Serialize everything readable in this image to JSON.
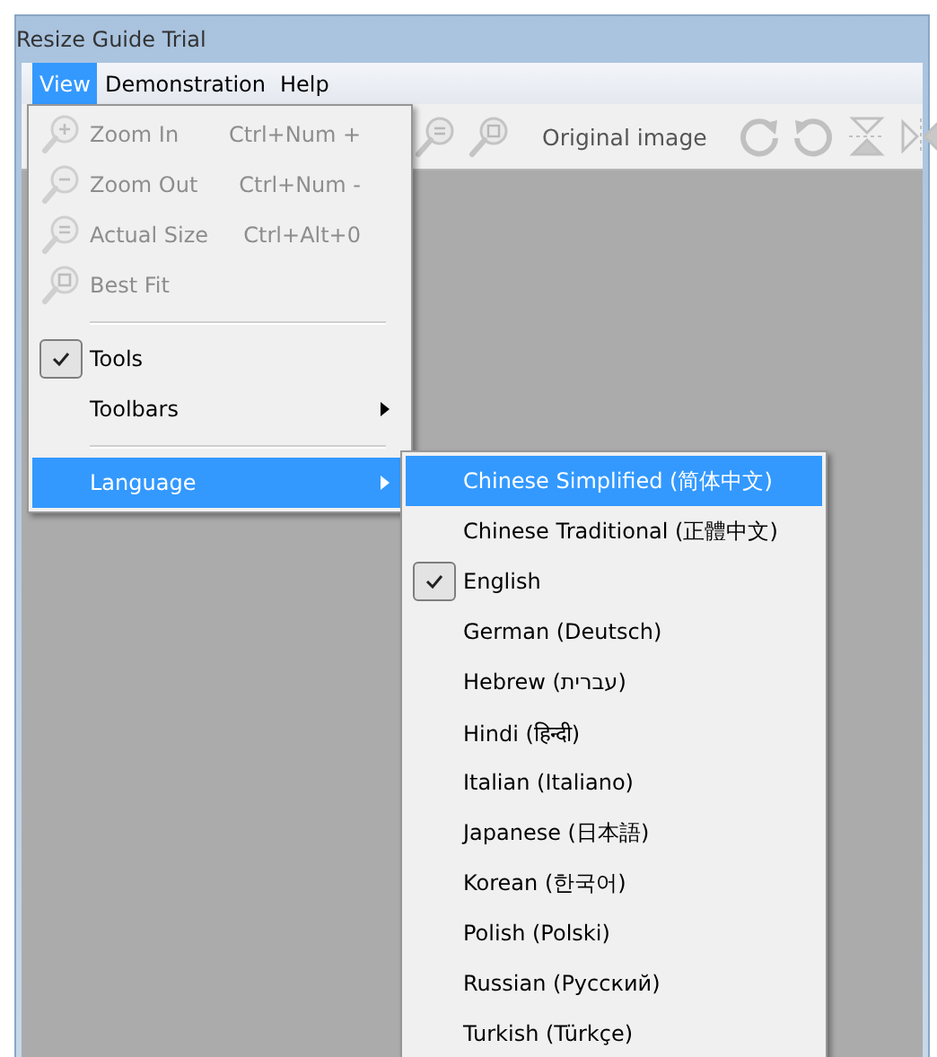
{
  "window": {
    "title": "Resize Guide Trial"
  },
  "menu_bar": [
    {
      "label": "View",
      "selected": true
    },
    {
      "label": "Demonstration",
      "selected": false
    },
    {
      "label": "Help",
      "selected": false
    }
  ],
  "toolbar": {
    "label": "Original image"
  },
  "view_menu": [
    {
      "kind": "command",
      "label": "Zoom In",
      "shortcut": "Ctrl+Num +",
      "disabled": true,
      "selected": false
    },
    {
      "kind": "command",
      "label": "Zoom Out",
      "shortcut": "Ctrl+Num -",
      "disabled": true,
      "selected": false
    },
    {
      "kind": "command",
      "label": "Actual Size",
      "shortcut": "Ctrl+Alt+0",
      "disabled": true,
      "selected": false
    },
    {
      "kind": "command",
      "label": "Best Fit",
      "disabled": true,
      "selected": false
    },
    {
      "kind": "separator"
    },
    {
      "kind": "check",
      "label": "Tools",
      "checked": true,
      "selected": false
    },
    {
      "kind": "submenu",
      "label": "Toolbars",
      "selected": false
    },
    {
      "kind": "separator"
    },
    {
      "kind": "submenu",
      "label": "Language",
      "selected": true
    }
  ],
  "language_menu": [
    {
      "label": "Chinese Simplified (简体中文)",
      "checked": false,
      "selected": true
    },
    {
      "label": "Chinese Traditional (正體中文)",
      "checked": false,
      "selected": false
    },
    {
      "label": "English",
      "checked": true,
      "selected": false
    },
    {
      "label": "German (Deutsch)",
      "checked": false,
      "selected": false
    },
    {
      "label": "Hebrew (עברית)",
      "checked": false,
      "selected": false
    },
    {
      "label": "Hindi (हिन्दी)",
      "checked": false,
      "selected": false
    },
    {
      "label": "Italian (Italiano)",
      "checked": false,
      "selected": false
    },
    {
      "label": "Japanese (日本語)",
      "checked": false,
      "selected": false
    },
    {
      "label": "Korean (한국어)",
      "checked": false,
      "selected": false
    },
    {
      "label": "Polish (Polski)",
      "checked": false,
      "selected": false
    },
    {
      "label": "Russian (Русский)",
      "checked": false,
      "selected": false
    },
    {
      "label": "Turkish (Türkçe)",
      "checked": false,
      "selected": false
    }
  ]
}
